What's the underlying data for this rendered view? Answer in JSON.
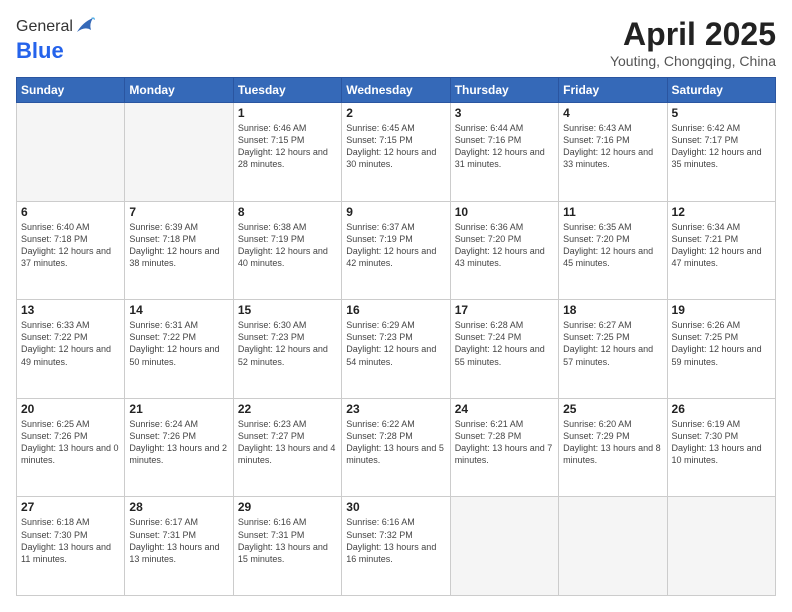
{
  "header": {
    "logo_line1": "General",
    "logo_line2": "Blue",
    "month_title": "April 2025",
    "location": "Youting, Chongqing, China"
  },
  "weekdays": [
    "Sunday",
    "Monday",
    "Tuesday",
    "Wednesday",
    "Thursday",
    "Friday",
    "Saturday"
  ],
  "weeks": [
    [
      {
        "day": "",
        "info": ""
      },
      {
        "day": "",
        "info": ""
      },
      {
        "day": "1",
        "info": "Sunrise: 6:46 AM\nSunset: 7:15 PM\nDaylight: 12 hours and 28 minutes."
      },
      {
        "day": "2",
        "info": "Sunrise: 6:45 AM\nSunset: 7:15 PM\nDaylight: 12 hours and 30 minutes."
      },
      {
        "day": "3",
        "info": "Sunrise: 6:44 AM\nSunset: 7:16 PM\nDaylight: 12 hours and 31 minutes."
      },
      {
        "day": "4",
        "info": "Sunrise: 6:43 AM\nSunset: 7:16 PM\nDaylight: 12 hours and 33 minutes."
      },
      {
        "day": "5",
        "info": "Sunrise: 6:42 AM\nSunset: 7:17 PM\nDaylight: 12 hours and 35 minutes."
      }
    ],
    [
      {
        "day": "6",
        "info": "Sunrise: 6:40 AM\nSunset: 7:18 PM\nDaylight: 12 hours and 37 minutes."
      },
      {
        "day": "7",
        "info": "Sunrise: 6:39 AM\nSunset: 7:18 PM\nDaylight: 12 hours and 38 minutes."
      },
      {
        "day": "8",
        "info": "Sunrise: 6:38 AM\nSunset: 7:19 PM\nDaylight: 12 hours and 40 minutes."
      },
      {
        "day": "9",
        "info": "Sunrise: 6:37 AM\nSunset: 7:19 PM\nDaylight: 12 hours and 42 minutes."
      },
      {
        "day": "10",
        "info": "Sunrise: 6:36 AM\nSunset: 7:20 PM\nDaylight: 12 hours and 43 minutes."
      },
      {
        "day": "11",
        "info": "Sunrise: 6:35 AM\nSunset: 7:20 PM\nDaylight: 12 hours and 45 minutes."
      },
      {
        "day": "12",
        "info": "Sunrise: 6:34 AM\nSunset: 7:21 PM\nDaylight: 12 hours and 47 minutes."
      }
    ],
    [
      {
        "day": "13",
        "info": "Sunrise: 6:33 AM\nSunset: 7:22 PM\nDaylight: 12 hours and 49 minutes."
      },
      {
        "day": "14",
        "info": "Sunrise: 6:31 AM\nSunset: 7:22 PM\nDaylight: 12 hours and 50 minutes."
      },
      {
        "day": "15",
        "info": "Sunrise: 6:30 AM\nSunset: 7:23 PM\nDaylight: 12 hours and 52 minutes."
      },
      {
        "day": "16",
        "info": "Sunrise: 6:29 AM\nSunset: 7:23 PM\nDaylight: 12 hours and 54 minutes."
      },
      {
        "day": "17",
        "info": "Sunrise: 6:28 AM\nSunset: 7:24 PM\nDaylight: 12 hours and 55 minutes."
      },
      {
        "day": "18",
        "info": "Sunrise: 6:27 AM\nSunset: 7:25 PM\nDaylight: 12 hours and 57 minutes."
      },
      {
        "day": "19",
        "info": "Sunrise: 6:26 AM\nSunset: 7:25 PM\nDaylight: 12 hours and 59 minutes."
      }
    ],
    [
      {
        "day": "20",
        "info": "Sunrise: 6:25 AM\nSunset: 7:26 PM\nDaylight: 13 hours and 0 minutes."
      },
      {
        "day": "21",
        "info": "Sunrise: 6:24 AM\nSunset: 7:26 PM\nDaylight: 13 hours and 2 minutes."
      },
      {
        "day": "22",
        "info": "Sunrise: 6:23 AM\nSunset: 7:27 PM\nDaylight: 13 hours and 4 minutes."
      },
      {
        "day": "23",
        "info": "Sunrise: 6:22 AM\nSunset: 7:28 PM\nDaylight: 13 hours and 5 minutes."
      },
      {
        "day": "24",
        "info": "Sunrise: 6:21 AM\nSunset: 7:28 PM\nDaylight: 13 hours and 7 minutes."
      },
      {
        "day": "25",
        "info": "Sunrise: 6:20 AM\nSunset: 7:29 PM\nDaylight: 13 hours and 8 minutes."
      },
      {
        "day": "26",
        "info": "Sunrise: 6:19 AM\nSunset: 7:30 PM\nDaylight: 13 hours and 10 minutes."
      }
    ],
    [
      {
        "day": "27",
        "info": "Sunrise: 6:18 AM\nSunset: 7:30 PM\nDaylight: 13 hours and 11 minutes."
      },
      {
        "day": "28",
        "info": "Sunrise: 6:17 AM\nSunset: 7:31 PM\nDaylight: 13 hours and 13 minutes."
      },
      {
        "day": "29",
        "info": "Sunrise: 6:16 AM\nSunset: 7:31 PM\nDaylight: 13 hours and 15 minutes."
      },
      {
        "day": "30",
        "info": "Sunrise: 6:16 AM\nSunset: 7:32 PM\nDaylight: 13 hours and 16 minutes."
      },
      {
        "day": "",
        "info": ""
      },
      {
        "day": "",
        "info": ""
      },
      {
        "day": "",
        "info": ""
      }
    ]
  ]
}
